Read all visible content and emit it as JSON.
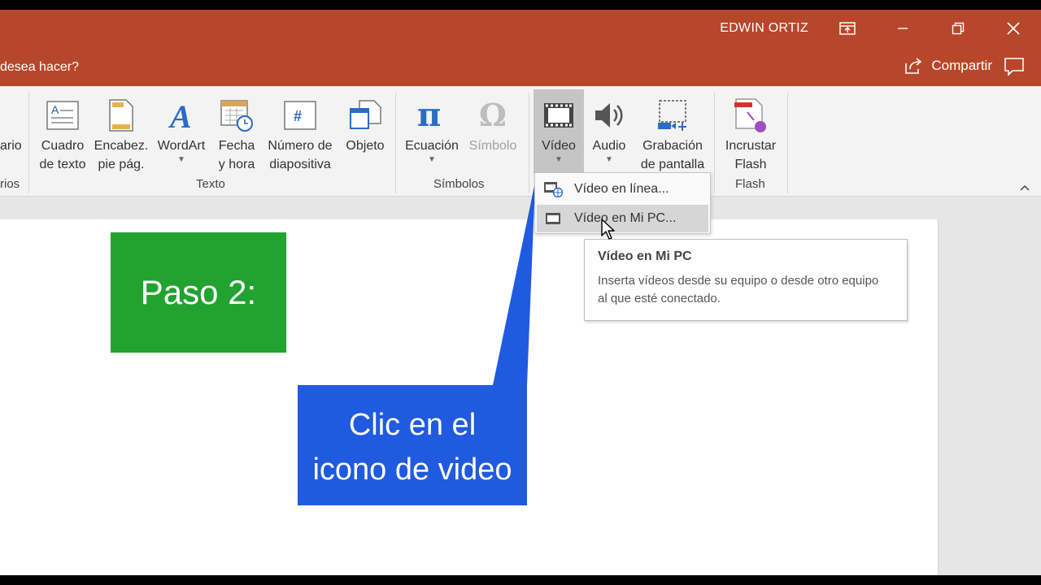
{
  "titlebar": {
    "user": "EDWIN ORTIZ",
    "tell_me": "desea hacer?",
    "share_label": "Compartir"
  },
  "ribbon": {
    "partial_left_label": "ario",
    "partial_left_group": "rios",
    "buttons": {
      "textbox": [
        "Cuadro",
        "de texto"
      ],
      "header": [
        "Encabez.",
        "pie pág."
      ],
      "wordart": "WordArt",
      "datetime": [
        "Fecha",
        "y hora"
      ],
      "slidenum": [
        "Número de",
        "diapositiva"
      ],
      "object": "Objeto",
      "equation": "Ecuación",
      "symbol": "Símbolo",
      "video": "Vídeo",
      "audio": "Audio",
      "screenrec": [
        "Grabación",
        "de pantalla"
      ],
      "flash": [
        "Incrustar",
        "Flash"
      ]
    },
    "groups": {
      "text": "Texto",
      "symbols": "Símbolos",
      "flash": "Flash"
    }
  },
  "video_menu": {
    "items": [
      "Vídeo en línea...",
      "Vídeo en Mi PC..."
    ]
  },
  "tooltip": {
    "title": "Vídeo en Mi PC",
    "description": "Inserta vídeos desde su equipo o desde otro equipo al que esté conectado."
  },
  "annotation": {
    "step": "Paso 2:",
    "callout_line1": "Clic en el",
    "callout_line2": "icono de video"
  },
  "colors": {
    "titlebar": "#b7472a",
    "step_box": "#22a230",
    "callout": "#1f5ae0"
  }
}
